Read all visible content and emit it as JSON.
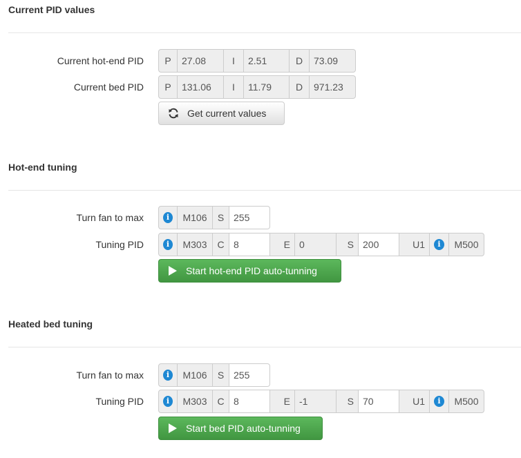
{
  "sections": {
    "current": {
      "title": "Current PID values",
      "hotend": {
        "label": "Current hot-end PID",
        "p_label": "P",
        "p": "27.08",
        "i_label": "I",
        "i": "2.51",
        "d_label": "D",
        "d": "73.09"
      },
      "bed": {
        "label": "Current bed PID",
        "p_label": "P",
        "p": "131.06",
        "i_label": "I",
        "i": "11.79",
        "d_label": "D",
        "d": "971.23"
      },
      "get_button": "Get current values"
    },
    "hotend_tuning": {
      "title": "Hot-end tuning",
      "fan": {
        "label": "Turn fan to max",
        "cmd": "M106",
        "s_label": "S",
        "s_value": "255"
      },
      "tuning": {
        "label": "Tuning PID",
        "cmd": "M303",
        "c_label": "C",
        "c_value": "8",
        "e_label": "E",
        "e_value": "0",
        "s_label": "S",
        "s_value": "200",
        "u_label": "U1",
        "save_cmd": "M500"
      },
      "start_button": "Start hot-end PID auto-tunning"
    },
    "bed_tuning": {
      "title": "Heated bed tuning",
      "fan": {
        "label": "Turn fan to max",
        "cmd": "M106",
        "s_label": "S",
        "s_value": "255"
      },
      "tuning": {
        "label": "Tuning PID",
        "cmd": "M303",
        "c_label": "C",
        "c_value": "8",
        "e_label": "E",
        "e_value": "-1",
        "s_label": "S",
        "s_value": "70",
        "u_label": "U1",
        "save_cmd": "M500"
      },
      "start_button": "Start bed PID auto-tunning"
    }
  },
  "icons": {
    "info": "info-icon",
    "refresh": "refresh-icon",
    "play": "play-icon"
  },
  "colors": {
    "success": "#5cb85c",
    "info": "#1e88d3"
  }
}
